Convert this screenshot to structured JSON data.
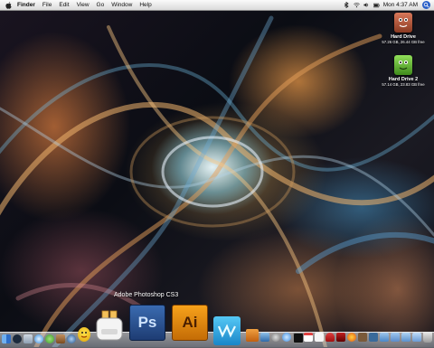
{
  "menubar": {
    "items": [
      "Finder",
      "File",
      "Edit",
      "View",
      "Go",
      "Window",
      "Help"
    ],
    "clock": "Mon 4:37 AM"
  },
  "desktop": {
    "drives": [
      {
        "name": "Hard Drive",
        "info": "57.26 GB, 26.44 GB free",
        "color": "#b4583a"
      },
      {
        "name": "Hard Drive 2",
        "info": "57.14 GB, 23.83 GB free",
        "color": "#6cbf3a"
      }
    ]
  },
  "dock": {
    "tooltip": "Adobe Photoshop CS3",
    "photoshop_label": "Ps",
    "illustrator_label": "Ai"
  },
  "colors": {
    "photoshop": "#2a5596",
    "illustrator": "#e88a10",
    "dreamweaver": "#2fa8e0"
  }
}
